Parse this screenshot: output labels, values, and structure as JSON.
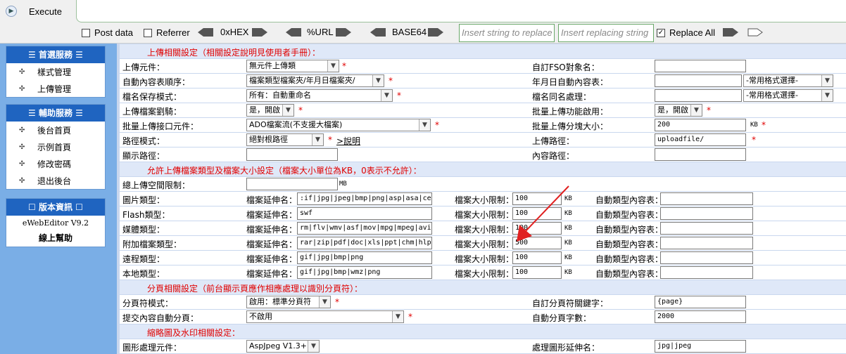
{
  "hackbar": {
    "execute_label": "Execute",
    "post_data": "Post data",
    "referrer": "Referrer",
    "hex": "0xHEX",
    "url": "%URL",
    "base64": "BASE64",
    "insert_placeholder": "Insert string to replace",
    "replacing_placeholder": "Insert replacing string",
    "replace_all": "Replace All",
    "replace_all_checked": true
  },
  "sidebar": {
    "section1": {
      "title": "首選服務",
      "items": [
        "樣式管理",
        "上傳管理"
      ]
    },
    "section2": {
      "title": "輔助服務",
      "items": [
        "後台首頁",
        "示例首頁",
        "修改密碼",
        "退出後台"
      ]
    },
    "section3": {
      "title": "版本資訊",
      "version": "eWebEditor V9.2",
      "help": "線上幫助"
    }
  },
  "form": {
    "upload_header": "上傳相關設定（相關設定說明見使用者手冊）：",
    "upload_component_label": "上傳元件：",
    "upload_component_value": "無元件上傳類",
    "custom_fso_label": "自訂FSO對象名：",
    "auto_dir_order_label": "自動內容表順序：",
    "auto_dir_order_value": "檔案類型檔案夾/年月日檔案夾/",
    "ymd_auto_dir_label": "年月日自動內容表：",
    "common_format": "-常用格式選擇-",
    "filename_mode_label": "檔名保存模式：",
    "filename_mode_value": "所有：自動重命名",
    "same_name_label": "檔名同名處理：",
    "upload_check_label": "上傳檔案劉騎：",
    "upload_check_value": "是，開啟",
    "batch_enable_label": "批量上傳功能啟用：",
    "batch_enable_value": "是，開啟",
    "batch_iface_label": "批量上傳接口元件：",
    "batch_iface_value": "ADO檔案流(不支援大檔案)",
    "batch_chunk_label": "批量上傳分塊大小：",
    "batch_chunk_value": "200",
    "kb": "KB",
    "mb": "MB",
    "path_mode_label": "路徑模式：",
    "path_mode_value": "絕對根路徑",
    "path_help": ">說明",
    "upload_path_label": "上傳路徑：",
    "upload_path_value": "uploadfile/",
    "display_path_label": "顯示路徑：",
    "content_path_label": "內容路徑：",
    "types_header": "允許上傳檔案類型及檔案大小設定（檔案大小單位為KB，0表示不允許）：",
    "total_space_label": "總上傳空間限制：",
    "ext_label": "檔案延伸名：",
    "size_limit_label": "檔案大小限制：",
    "auto_type_dir_label": "自動類型內容表：",
    "file_types": [
      {
        "label": "圖片類型：",
        "ext": ":if|jpg|jpeg|bmp|png|asp|asa|cer",
        "size": "100"
      },
      {
        "label": "Flash類型：",
        "ext": "swf",
        "size": "100"
      },
      {
        "label": "媒體類型：",
        "ext": "rm|flv|wmv|asf|mov|mpg|mpeg|avi",
        "size": "100"
      },
      {
        "label": "附加檔案類型：",
        "ext": "rar|zip|pdf|doc|xls|ppt|chm|hlp",
        "size": "500"
      },
      {
        "label": "遠程類型：",
        "ext": "gif|jpg|bmp|png",
        "size": "100"
      },
      {
        "label": "本地類型：",
        "ext": "gif|jpg|bmp|wmz|png",
        "size": "100"
      }
    ],
    "page_header": "分頁相關設定（前台顯示頁應作相應處理以識別分頁符）：",
    "page_mode_label": "分頁符模式：",
    "page_mode_value": "啟用：標準分頁符",
    "page_keyword_label": "自訂分頁符關鍵字：",
    "page_keyword_value": "{page}",
    "auto_page_label": "提交內容自動分頁：",
    "auto_page_value": "不啟用",
    "auto_page_chars_label": "自動分頁字數：",
    "auto_page_chars_value": "2000",
    "thumb_header": "縮略圖及水印相關設定：",
    "image_comp_label": "圖形處理元件：",
    "image_comp_value": "AspJpeg V1.3+",
    "image_ext_label": "處理圖形延伸名：",
    "image_ext_value": "jpg|jpeg"
  },
  "colors": {
    "sidebar_bg": "#7aaee6",
    "sidebar_header": "#1f64c0",
    "form_bg": "#c9d7ee",
    "required_star": "#e00000",
    "annotation_arrow": "#e02020"
  }
}
